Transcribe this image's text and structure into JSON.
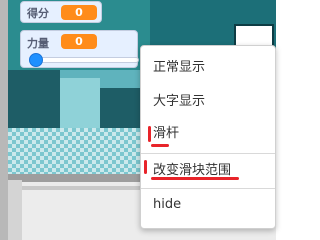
{
  "monitors": {
    "score": {
      "label": "得分",
      "value": "0"
    },
    "power": {
      "label": "力量",
      "value": "0",
      "slider_level": 0
    }
  },
  "context_menu": {
    "items": [
      {
        "label": "正常显示"
      },
      {
        "label": "大字显示"
      },
      {
        "label": "滑杆"
      },
      {
        "label": "改变滑块范围"
      },
      {
        "label": "hide"
      }
    ]
  },
  "colors": {
    "monitor_value": "#ff8c1a",
    "slider_thumb": "#1e90ff",
    "annotation": "#e8242a",
    "stage_teal": "#5fb3bd"
  }
}
